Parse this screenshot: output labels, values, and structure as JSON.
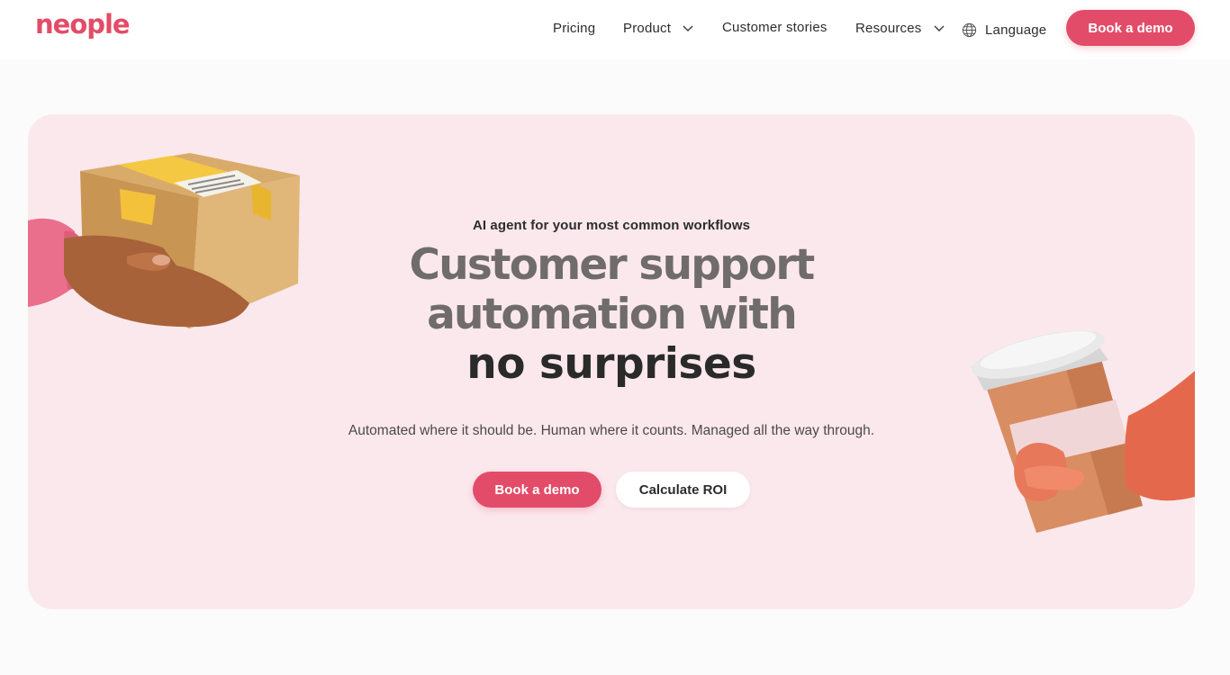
{
  "header": {
    "logo": "neople",
    "nav": {
      "pricing": "Pricing",
      "product": "Product",
      "customer_stories": "Customer stories",
      "resources": "Resources",
      "language": "Language"
    },
    "cta": "Book a demo"
  },
  "hero": {
    "eyebrow": "AI agent for your most common workflows",
    "headline_line1": "Customer support",
    "headline_line2": "automation with",
    "headline_line3": "no surprises",
    "subtitle": "Automated where it should be. Human where it counts. Managed all the way through.",
    "primary_cta": "Book a demo",
    "secondary_cta": "Calculate ROI",
    "left_illustration": "hand-holding-package-icon",
    "right_illustration": "hand-holding-coffee-cup-icon"
  },
  "colors": {
    "brand": "#e24c68",
    "hero_background": "#fbe8ed",
    "page_background": "#fcfbfc",
    "headline_gray": "#6f6c6b",
    "headline_dark": "#2a2a2a"
  },
  "icons": {
    "dropdown": "chevron-down-icon",
    "language": "globe-icon"
  }
}
